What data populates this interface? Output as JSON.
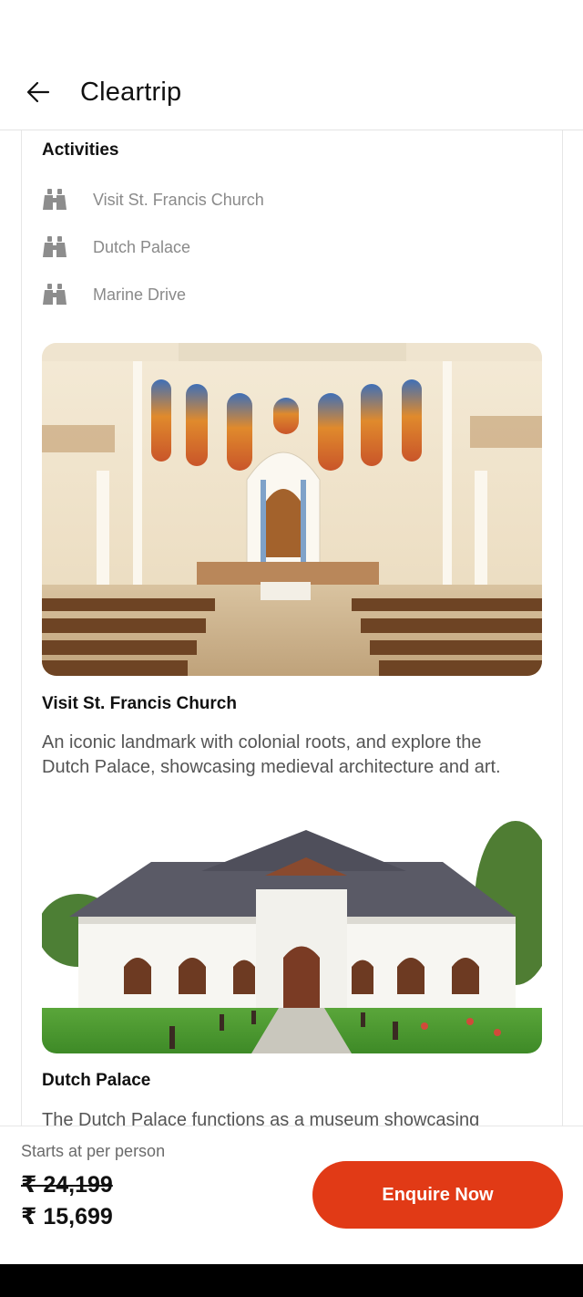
{
  "header": {
    "title": "Cleartrip",
    "back_icon": "arrow-left-icon"
  },
  "activities": {
    "heading": "Activities",
    "items": [
      {
        "label": "Visit St. Francis Church",
        "icon": "binoculars-icon"
      },
      {
        "label": "Dutch Palace",
        "icon": "binoculars-icon"
      },
      {
        "label": "Marine Drive",
        "icon": "binoculars-icon"
      }
    ]
  },
  "cards": [
    {
      "title": "Visit St. Francis Church",
      "description": "An iconic landmark with colonial roots, and explore the Dutch Palace, showcasing medieval architecture and art."
    },
    {
      "title": "Dutch Palace",
      "description": "The Dutch Palace functions as a museum showcasing"
    }
  ],
  "footer": {
    "price_label": "Starts at per person",
    "original_price": "₹ 24,199",
    "price": "₹ 15,699",
    "cta_label": "Enquire Now"
  },
  "colors": {
    "accent": "#e13a16",
    "muted_text": "#8a8a8a",
    "icon_gray": "#8d8d8d"
  }
}
